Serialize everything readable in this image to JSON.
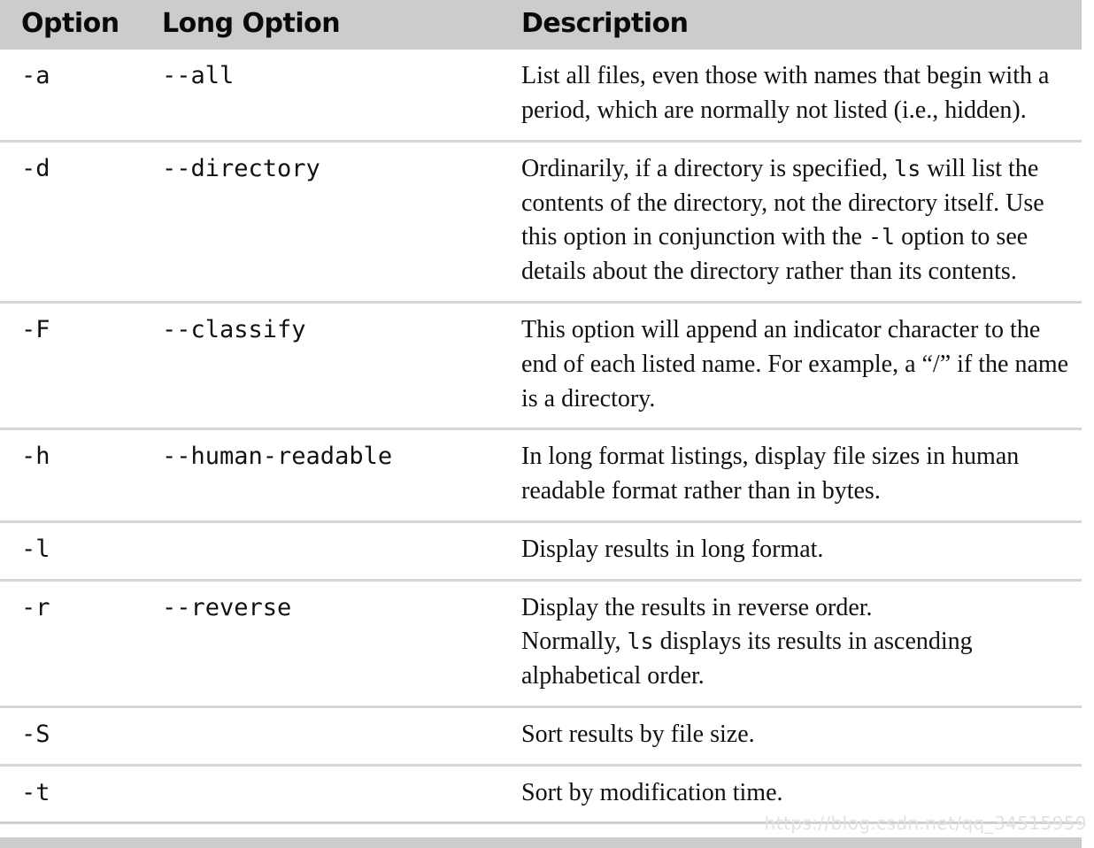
{
  "table": {
    "headers": {
      "option": "Option",
      "long_option": "Long Option",
      "description": "Description"
    },
    "rows": [
      {
        "option": "-a",
        "long_option": "--all",
        "description_lines": [
          "List all files, even those with names that begin with a period, which are normally not listed (i.e., hidden)."
        ]
      },
      {
        "option": "-d",
        "long_option": "--directory",
        "description_lines": [
          "Ordinarily, if a directory is specified, |ls| will list the contents of the directory, not the directory itself.  Use this option in conjunction with the |-l| option to see details about the directory rather than its contents."
        ]
      },
      {
        "option": "-F",
        "long_option": "--classify",
        "description_lines": [
          "This option will append an indicator character to the end of each listed name.  For example, a “/” if the name is a directory."
        ]
      },
      {
        "option": "-h",
        "long_option": "--human-readable",
        "description_lines": [
          "In long format listings, display file sizes in human readable format rather than in bytes."
        ]
      },
      {
        "option": "-l",
        "long_option": "",
        "description_lines": [
          "Display results in long format."
        ]
      },
      {
        "option": "-r",
        "long_option": "--reverse",
        "description_lines": [
          "Display the results in reverse order.",
          "Normally, |ls| displays its results in ascending alphabetical order."
        ]
      },
      {
        "option": "-S",
        "long_option": "",
        "description_lines": [
          "Sort results by file size."
        ]
      },
      {
        "option": "-t",
        "long_option": "",
        "description_lines": [
          "Sort by modification time."
        ]
      }
    ]
  },
  "watermark": {
    "text": "https://blog.csdn.net/qq_34515959"
  },
  "colors": {
    "header_background": "#cccccc",
    "row_separator": "#d6d6d6",
    "text": "#111111",
    "watermark": "#e2e2e2"
  }
}
